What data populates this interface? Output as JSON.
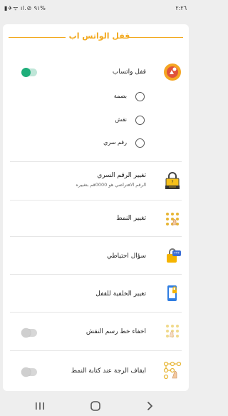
{
  "status_bar": {
    "time": "٢:٢٦",
    "icons_text": "▮✈ᯤ ıl.⊘ ٩١%"
  },
  "header": {
    "title": "قفل الواتس اب"
  },
  "lock": {
    "label": "قفل واتساب",
    "enabled": true,
    "options": [
      {
        "label": "بصمة"
      },
      {
        "label": "نقش"
      },
      {
        "label": "رقم سري"
      }
    ]
  },
  "settings": [
    {
      "label": "تغيير الرقم السري",
      "sub": "الرقم الافتراضي هو 0000قم بتغييره",
      "icon": "lock-password-icon"
    },
    {
      "label": "تغيير النمط",
      "icon": "pattern-icon"
    },
    {
      "label": "سؤال احتياطي",
      "icon": "security-question-icon"
    },
    {
      "label": "تغيير الخلفية للقفل",
      "icon": "phone-wallpaper-icon"
    },
    {
      "label": "اخفاء خط رسم النقش",
      "icon": "hide-pattern-icon",
      "toggle": false
    },
    {
      "label": "ايقاف الرجة عند كتابة النمط",
      "icon": "vibration-pattern-icon",
      "toggle": false
    }
  ],
  "colors": {
    "accent": "#f2a81d",
    "toggle_on": "#1fae7a"
  },
  "nav": {
    "recents": "recents-icon",
    "home": "home-icon",
    "back": "back-icon"
  }
}
